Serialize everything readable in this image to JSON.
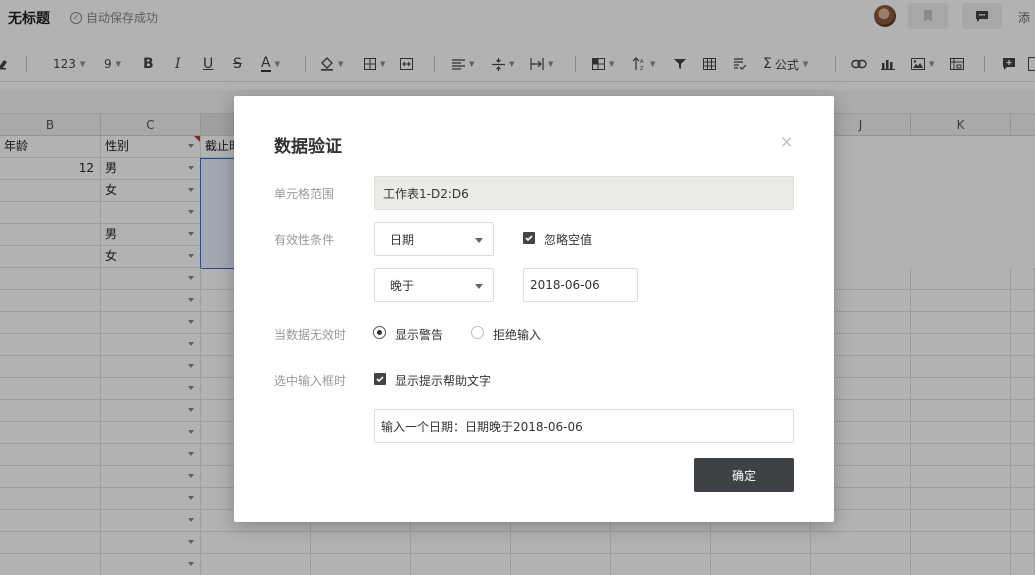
{
  "header": {
    "doc_title": "无标题",
    "save_status": "自动保存成功",
    "truncated_btn": "添"
  },
  "toolbar": {
    "number_format": "123",
    "font_size": "9",
    "bold": "B",
    "italic": "I",
    "underline": "U",
    "strike": "S",
    "font_color": "A",
    "formula": "公式",
    "sigma": "Σ"
  },
  "sheet": {
    "columns": [
      "B",
      "C",
      "",
      "J",
      "K"
    ],
    "header_row": {
      "b": "年龄",
      "c": "性别",
      "d": "截止时"
    },
    "rows": [
      {
        "b": "12",
        "c": "男"
      },
      {
        "b": "",
        "c": "女"
      },
      {
        "b": "",
        "c": ""
      },
      {
        "b": "",
        "c": "男"
      },
      {
        "b": "",
        "c": "女"
      }
    ]
  },
  "dialog": {
    "title": "数据验证",
    "close_symbol": "×",
    "range_label": "单元格范围",
    "range_value": "工作表1-D2:D6",
    "condition_label": "有效性条件",
    "condition_type": "日期",
    "ignore_blank_label": "忽略空值",
    "ignore_blank_checked": true,
    "operator": "晚于",
    "date_value": "2018-06-06",
    "invalid_label": "当数据无效时",
    "show_warning_label": "显示警告",
    "reject_input_label": "拒绝输入",
    "selected_invalid_option": "显示警告",
    "on_select_label": "选中输入框时",
    "show_help_label": "显示提示帮助文字",
    "show_help_checked": true,
    "help_text": "输入一个日期：日期晚于2018-06-06",
    "confirm_label": "确定"
  }
}
